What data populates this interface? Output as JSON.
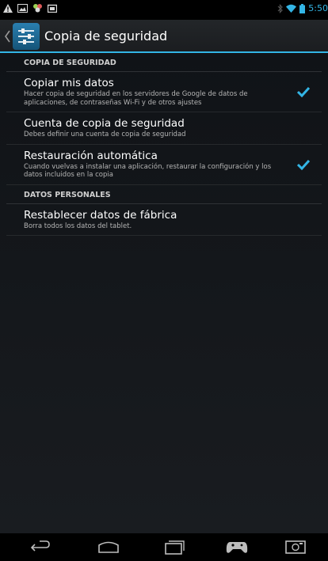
{
  "status": {
    "time": "5:50",
    "accent": "#33b5e5"
  },
  "actionbar": {
    "title": "Copia de seguridad"
  },
  "sections": [
    {
      "header": "COPIA DE SEGURIDAD",
      "items": [
        {
          "title": "Copiar mis datos",
          "summary": "Hacer copia de seguridad en los servidores de Google de datos de aplicaciones, de contraseñas Wi-Fi y de otros ajustes",
          "checked": true
        },
        {
          "title": "Cuenta de copia de seguridad",
          "summary": "Debes definir una cuenta de copia de seguridad",
          "checked": false
        },
        {
          "title": "Restauración automática",
          "summary": "Cuando vuelvas a instalar una aplicación, restaurar la configuración y los datos incluidos en la copia",
          "checked": true
        }
      ]
    },
    {
      "header": "DATOS PERSONALES",
      "items": [
        {
          "title": "Restablecer datos de fábrica",
          "summary": "Borra todos los datos del tablet."
        }
      ]
    }
  ],
  "navbar": {
    "buttons": [
      "back",
      "home",
      "recents",
      "game",
      "screenshot"
    ]
  }
}
